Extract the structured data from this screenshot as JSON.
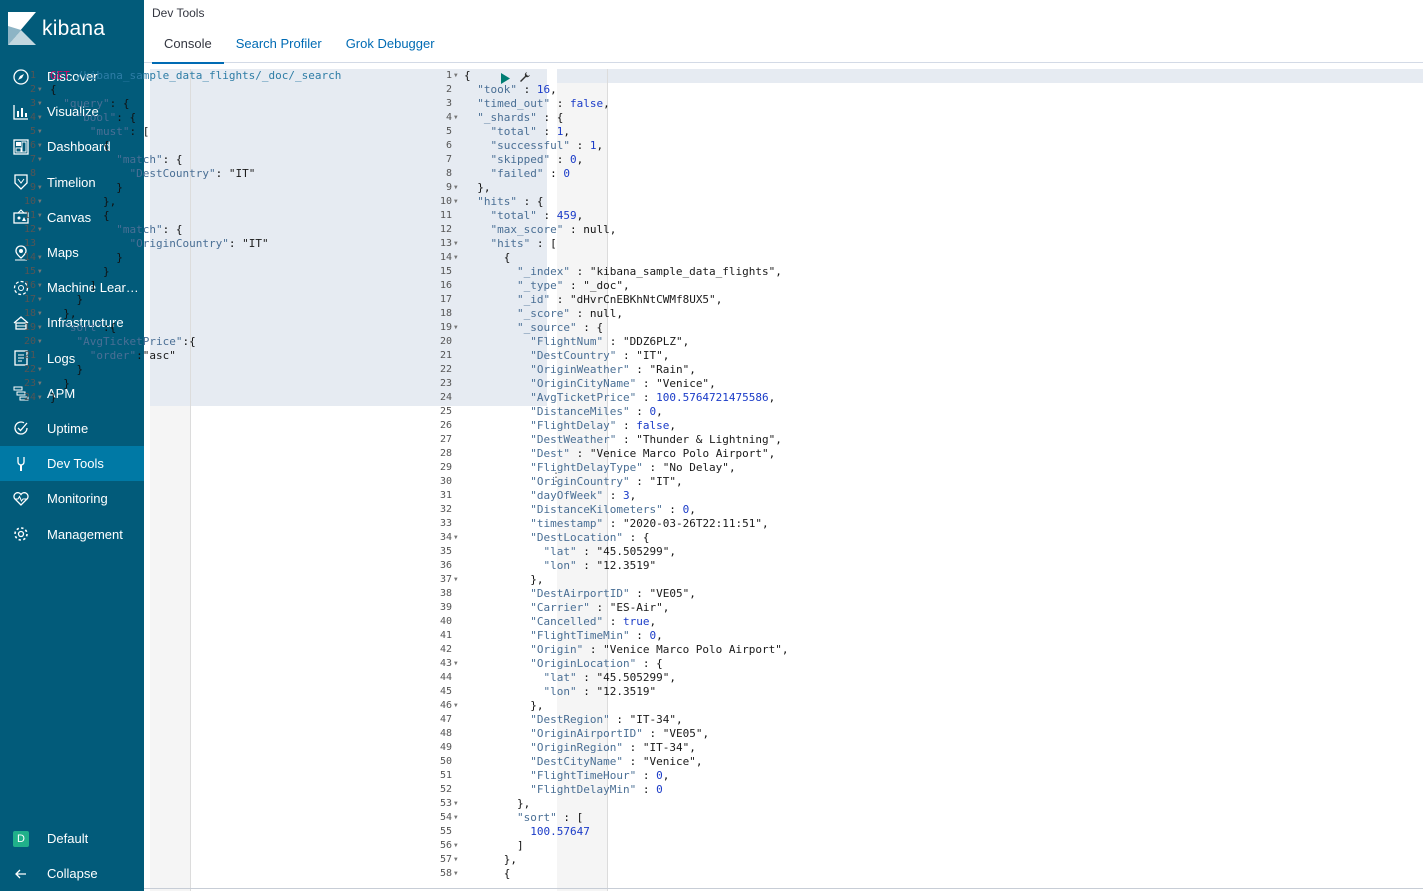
{
  "app": {
    "brand": "kibana",
    "title": "Dev Tools"
  },
  "colors": {
    "sidebar": "#025b7a",
    "active_nav": "#0079a5",
    "link": "#006bb4",
    "method": "#c80a68"
  },
  "sidebar": {
    "items": [
      {
        "label": "Discover",
        "icon": "compass-icon",
        "active": false
      },
      {
        "label": "Visualize",
        "icon": "bar-chart-icon",
        "active": false
      },
      {
        "label": "Dashboard",
        "icon": "dashboard-icon",
        "active": false
      },
      {
        "label": "Timelion",
        "icon": "shield-icon",
        "active": false
      },
      {
        "label": "Canvas",
        "icon": "canvas-icon",
        "active": false
      },
      {
        "label": "Maps",
        "icon": "map-pin-icon",
        "active": false
      },
      {
        "label": "Machine Learning",
        "icon": "machine-learning-icon",
        "active": false
      },
      {
        "label": "Infrastructure",
        "icon": "infrastructure-icon",
        "active": false
      },
      {
        "label": "Logs",
        "icon": "logs-icon",
        "active": false
      },
      {
        "label": "APM",
        "icon": "apm-icon",
        "active": false
      },
      {
        "label": "Uptime",
        "icon": "uptime-icon",
        "active": false
      },
      {
        "label": "Dev Tools",
        "icon": "wrench-icon",
        "active": true
      },
      {
        "label": "Monitoring",
        "icon": "heartbeat-icon",
        "active": false
      },
      {
        "label": "Management",
        "icon": "gear-icon",
        "active": false
      }
    ],
    "space": {
      "avatar": "D",
      "label": "Default"
    },
    "collapse": "Collapse"
  },
  "tabs": [
    {
      "label": "Console",
      "active": true
    },
    {
      "label": "Search Profiler",
      "active": false
    },
    {
      "label": "Grok Debugger",
      "active": false
    }
  ],
  "request": [
    [
      [
        "kw",
        "GET"
      ],
      [
        "url",
        " /kibana_sample_data_flights/_doc/_search"
      ]
    ],
    [
      [
        "pun",
        "{"
      ]
    ],
    [
      [
        "pun",
        "  "
      ],
      [
        "key",
        "\"query\""
      ],
      [
        "pun",
        ": {"
      ]
    ],
    [
      [
        "pun",
        "    "
      ],
      [
        "key",
        "\"bool\""
      ],
      [
        "pun",
        ": {"
      ]
    ],
    [
      [
        "pun",
        "      "
      ],
      [
        "key",
        "\"must\""
      ],
      [
        "pun",
        ": ["
      ]
    ],
    [
      [
        "pun",
        "        {"
      ]
    ],
    [
      [
        "pun",
        "          "
      ],
      [
        "key",
        "\"match\""
      ],
      [
        "pun",
        ": {"
      ]
    ],
    [
      [
        "pun",
        "            "
      ],
      [
        "key",
        "\"DestCountry\""
      ],
      [
        "pun",
        ": "
      ],
      [
        "str",
        "\"IT\""
      ]
    ],
    [
      [
        "pun",
        "          }"
      ]
    ],
    [
      [
        "pun",
        "        },"
      ]
    ],
    [
      [
        "pun",
        "        {"
      ]
    ],
    [
      [
        "pun",
        "          "
      ],
      [
        "key",
        "\"match\""
      ],
      [
        "pun",
        ": {"
      ]
    ],
    [
      [
        "pun",
        "            "
      ],
      [
        "key",
        "\"OriginCountry\""
      ],
      [
        "pun",
        ": "
      ],
      [
        "str",
        "\"IT\""
      ]
    ],
    [
      [
        "pun",
        "          }"
      ]
    ],
    [
      [
        "pun",
        "        }"
      ]
    ],
    [
      [
        "pun",
        "      ]"
      ]
    ],
    [
      [
        "pun",
        "    }"
      ]
    ],
    [
      [
        "pun",
        "  },"
      ]
    ],
    [
      [
        "pun",
        "  "
      ],
      [
        "key",
        "\"sort\""
      ],
      [
        "pun",
        ":{"
      ]
    ],
    [
      [
        "pun",
        "    "
      ],
      [
        "key",
        "\"AvgTicketPrice\""
      ],
      [
        "pun",
        ":{"
      ]
    ],
    [
      [
        "pun",
        "      "
      ],
      [
        "key",
        "\"order\""
      ],
      [
        "pun",
        ":"
      ],
      [
        "str",
        "\"asc\""
      ]
    ],
    [
      [
        "pun",
        "    }"
      ]
    ],
    [
      [
        "pun",
        "  }"
      ]
    ],
    [
      [
        "pun",
        "}"
      ]
    ]
  ],
  "request_folds": [
    2,
    3,
    4,
    5,
    6,
    7,
    9,
    10,
    11,
    12,
    14,
    15,
    16,
    17,
    18,
    19,
    20,
    22,
    23,
    24
  ],
  "response": [
    [
      [
        "pun",
        "{"
      ]
    ],
    [
      [
        "pun",
        "  "
      ],
      [
        "key",
        "\"took\""
      ],
      [
        "pun",
        " : "
      ],
      [
        "num",
        "16"
      ],
      [
        "pun",
        ","
      ]
    ],
    [
      [
        "pun",
        "  "
      ],
      [
        "key",
        "\"timed_out\""
      ],
      [
        "pun",
        " : "
      ],
      [
        "bool",
        "false"
      ],
      [
        "pun",
        ","
      ]
    ],
    [
      [
        "pun",
        "  "
      ],
      [
        "key",
        "\"_shards\""
      ],
      [
        "pun",
        " : {"
      ]
    ],
    [
      [
        "pun",
        "    "
      ],
      [
        "key",
        "\"total\""
      ],
      [
        "pun",
        " : "
      ],
      [
        "num",
        "1"
      ],
      [
        "pun",
        ","
      ]
    ],
    [
      [
        "pun",
        "    "
      ],
      [
        "key",
        "\"successful\""
      ],
      [
        "pun",
        " : "
      ],
      [
        "num",
        "1"
      ],
      [
        "pun",
        ","
      ]
    ],
    [
      [
        "pun",
        "    "
      ],
      [
        "key",
        "\"skipped\""
      ],
      [
        "pun",
        " : "
      ],
      [
        "num",
        "0"
      ],
      [
        "pun",
        ","
      ]
    ],
    [
      [
        "pun",
        "    "
      ],
      [
        "key",
        "\"failed\""
      ],
      [
        "pun",
        " : "
      ],
      [
        "num",
        "0"
      ]
    ],
    [
      [
        "pun",
        "  },"
      ]
    ],
    [
      [
        "pun",
        "  "
      ],
      [
        "key",
        "\"hits\""
      ],
      [
        "pun",
        " : {"
      ]
    ],
    [
      [
        "pun",
        "    "
      ],
      [
        "key",
        "\"total\""
      ],
      [
        "pun",
        " : "
      ],
      [
        "num",
        "459"
      ],
      [
        "pun",
        ","
      ]
    ],
    [
      [
        "pun",
        "    "
      ],
      [
        "key",
        "\"max_score\""
      ],
      [
        "pun",
        " : null,"
      ]
    ],
    [
      [
        "pun",
        "    "
      ],
      [
        "key",
        "\"hits\""
      ],
      [
        "pun",
        " : ["
      ]
    ],
    [
      [
        "pun",
        "      {"
      ]
    ],
    [
      [
        "pun",
        "        "
      ],
      [
        "key",
        "\"_index\""
      ],
      [
        "pun",
        " : "
      ],
      [
        "str",
        "\"kibana_sample_data_flights\""
      ],
      [
        "pun",
        ","
      ]
    ],
    [
      [
        "pun",
        "        "
      ],
      [
        "key",
        "\"_type\""
      ],
      [
        "pun",
        " : "
      ],
      [
        "str",
        "\"_doc\""
      ],
      [
        "pun",
        ","
      ]
    ],
    [
      [
        "pun",
        "        "
      ],
      [
        "key",
        "\"_id\""
      ],
      [
        "pun",
        " : "
      ],
      [
        "str",
        "\"dHvrCnEBKhNtCWMf8UX5\""
      ],
      [
        "pun",
        ","
      ]
    ],
    [
      [
        "pun",
        "        "
      ],
      [
        "key",
        "\"_score\""
      ],
      [
        "pun",
        " : null,"
      ]
    ],
    [
      [
        "pun",
        "        "
      ],
      [
        "key",
        "\"_source\""
      ],
      [
        "pun",
        " : {"
      ]
    ],
    [
      [
        "pun",
        "          "
      ],
      [
        "key",
        "\"FlightNum\""
      ],
      [
        "pun",
        " : "
      ],
      [
        "str",
        "\"DDZ6PLZ\""
      ],
      [
        "pun",
        ","
      ]
    ],
    [
      [
        "pun",
        "          "
      ],
      [
        "key",
        "\"DestCountry\""
      ],
      [
        "pun",
        " : "
      ],
      [
        "str",
        "\"IT\""
      ],
      [
        "pun",
        ","
      ]
    ],
    [
      [
        "pun",
        "          "
      ],
      [
        "key",
        "\"OriginWeather\""
      ],
      [
        "pun",
        " : "
      ],
      [
        "str",
        "\"Rain\""
      ],
      [
        "pun",
        ","
      ]
    ],
    [
      [
        "pun",
        "          "
      ],
      [
        "key",
        "\"OriginCityName\""
      ],
      [
        "pun",
        " : "
      ],
      [
        "str",
        "\"Venice\""
      ],
      [
        "pun",
        ","
      ]
    ],
    [
      [
        "pun",
        "          "
      ],
      [
        "key",
        "\"AvgTicketPrice\""
      ],
      [
        "pun",
        " : "
      ],
      [
        "num",
        "100.5764721475586"
      ],
      [
        "pun",
        ","
      ]
    ],
    [
      [
        "pun",
        "          "
      ],
      [
        "key",
        "\"DistanceMiles\""
      ],
      [
        "pun",
        " : "
      ],
      [
        "num",
        "0"
      ],
      [
        "pun",
        ","
      ]
    ],
    [
      [
        "pun",
        "          "
      ],
      [
        "key",
        "\"FlightDelay\""
      ],
      [
        "pun",
        " : "
      ],
      [
        "bool",
        "false"
      ],
      [
        "pun",
        ","
      ]
    ],
    [
      [
        "pun",
        "          "
      ],
      [
        "key",
        "\"DestWeather\""
      ],
      [
        "pun",
        " : "
      ],
      [
        "str",
        "\"Thunder & Lightning\""
      ],
      [
        "pun",
        ","
      ]
    ],
    [
      [
        "pun",
        "          "
      ],
      [
        "key",
        "\"Dest\""
      ],
      [
        "pun",
        " : "
      ],
      [
        "str",
        "\"Venice Marco Polo Airport\""
      ],
      [
        "pun",
        ","
      ]
    ],
    [
      [
        "pun",
        "          "
      ],
      [
        "key",
        "\"FlightDelayType\""
      ],
      [
        "pun",
        " : "
      ],
      [
        "str",
        "\"No Delay\""
      ],
      [
        "pun",
        ","
      ]
    ],
    [
      [
        "pun",
        "          "
      ],
      [
        "key",
        "\"OriginCountry\""
      ],
      [
        "pun",
        " : "
      ],
      [
        "str",
        "\"IT\""
      ],
      [
        "pun",
        ","
      ]
    ],
    [
      [
        "pun",
        "          "
      ],
      [
        "key",
        "\"dayOfWeek\""
      ],
      [
        "pun",
        " : "
      ],
      [
        "num",
        "3"
      ],
      [
        "pun",
        ","
      ]
    ],
    [
      [
        "pun",
        "          "
      ],
      [
        "key",
        "\"DistanceKilometers\""
      ],
      [
        "pun",
        " : "
      ],
      [
        "num",
        "0"
      ],
      [
        "pun",
        ","
      ]
    ],
    [
      [
        "pun",
        "          "
      ],
      [
        "key",
        "\"timestamp\""
      ],
      [
        "pun",
        " : "
      ],
      [
        "str",
        "\"2020-03-26T22:11:51\""
      ],
      [
        "pun",
        ","
      ]
    ],
    [
      [
        "pun",
        "          "
      ],
      [
        "key",
        "\"DestLocation\""
      ],
      [
        "pun",
        " : {"
      ]
    ],
    [
      [
        "pun",
        "            "
      ],
      [
        "key",
        "\"lat\""
      ],
      [
        "pun",
        " : "
      ],
      [
        "str",
        "\"45.505299\""
      ],
      [
        "pun",
        ","
      ]
    ],
    [
      [
        "pun",
        "            "
      ],
      [
        "key",
        "\"lon\""
      ],
      [
        "pun",
        " : "
      ],
      [
        "str",
        "\"12.3519\""
      ]
    ],
    [
      [
        "pun",
        "          },"
      ]
    ],
    [
      [
        "pun",
        "          "
      ],
      [
        "key",
        "\"DestAirportID\""
      ],
      [
        "pun",
        " : "
      ],
      [
        "str",
        "\"VE05\""
      ],
      [
        "pun",
        ","
      ]
    ],
    [
      [
        "pun",
        "          "
      ],
      [
        "key",
        "\"Carrier\""
      ],
      [
        "pun",
        " : "
      ],
      [
        "str",
        "\"ES-Air\""
      ],
      [
        "pun",
        ","
      ]
    ],
    [
      [
        "pun",
        "          "
      ],
      [
        "key",
        "\"Cancelled\""
      ],
      [
        "pun",
        " : "
      ],
      [
        "bool",
        "true"
      ],
      [
        "pun",
        ","
      ]
    ],
    [
      [
        "pun",
        "          "
      ],
      [
        "key",
        "\"FlightTimeMin\""
      ],
      [
        "pun",
        " : "
      ],
      [
        "num",
        "0"
      ],
      [
        "pun",
        ","
      ]
    ],
    [
      [
        "pun",
        "          "
      ],
      [
        "key",
        "\"Origin\""
      ],
      [
        "pun",
        " : "
      ],
      [
        "str",
        "\"Venice Marco Polo Airport\""
      ],
      [
        "pun",
        ","
      ]
    ],
    [
      [
        "pun",
        "          "
      ],
      [
        "key",
        "\"OriginLocation\""
      ],
      [
        "pun",
        " : {"
      ]
    ],
    [
      [
        "pun",
        "            "
      ],
      [
        "key",
        "\"lat\""
      ],
      [
        "pun",
        " : "
      ],
      [
        "str",
        "\"45.505299\""
      ],
      [
        "pun",
        ","
      ]
    ],
    [
      [
        "pun",
        "            "
      ],
      [
        "key",
        "\"lon\""
      ],
      [
        "pun",
        " : "
      ],
      [
        "str",
        "\"12.3519\""
      ]
    ],
    [
      [
        "pun",
        "          },"
      ]
    ],
    [
      [
        "pun",
        "          "
      ],
      [
        "key",
        "\"DestRegion\""
      ],
      [
        "pun",
        " : "
      ],
      [
        "str",
        "\"IT-34\""
      ],
      [
        "pun",
        ","
      ]
    ],
    [
      [
        "pun",
        "          "
      ],
      [
        "key",
        "\"OriginAirportID\""
      ],
      [
        "pun",
        " : "
      ],
      [
        "str",
        "\"VE05\""
      ],
      [
        "pun",
        ","
      ]
    ],
    [
      [
        "pun",
        "          "
      ],
      [
        "key",
        "\"OriginRegion\""
      ],
      [
        "pun",
        " : "
      ],
      [
        "str",
        "\"IT-34\""
      ],
      [
        "pun",
        ","
      ]
    ],
    [
      [
        "pun",
        "          "
      ],
      [
        "key",
        "\"DestCityName\""
      ],
      [
        "pun",
        " : "
      ],
      [
        "str",
        "\"Venice\""
      ],
      [
        "pun",
        ","
      ]
    ],
    [
      [
        "pun",
        "          "
      ],
      [
        "key",
        "\"FlightTimeHour\""
      ],
      [
        "pun",
        " : "
      ],
      [
        "num",
        "0"
      ],
      [
        "pun",
        ","
      ]
    ],
    [
      [
        "pun",
        "          "
      ],
      [
        "key",
        "\"FlightDelayMin\""
      ],
      [
        "pun",
        " : "
      ],
      [
        "num",
        "0"
      ]
    ],
    [
      [
        "pun",
        "        },"
      ]
    ],
    [
      [
        "pun",
        "        "
      ],
      [
        "key",
        "\"sort\""
      ],
      [
        "pun",
        " : ["
      ]
    ],
    [
      [
        "pun",
        "          "
      ],
      [
        "num",
        "100.57647"
      ]
    ],
    [
      [
        "pun",
        "        ]"
      ]
    ],
    [
      [
        "pun",
        "      },"
      ]
    ],
    [
      [
        "pun",
        "      {"
      ]
    ]
  ],
  "response_folds": [
    1,
    4,
    9,
    10,
    13,
    14,
    19,
    34,
    37,
    43,
    46,
    53,
    54,
    56,
    57,
    58
  ]
}
